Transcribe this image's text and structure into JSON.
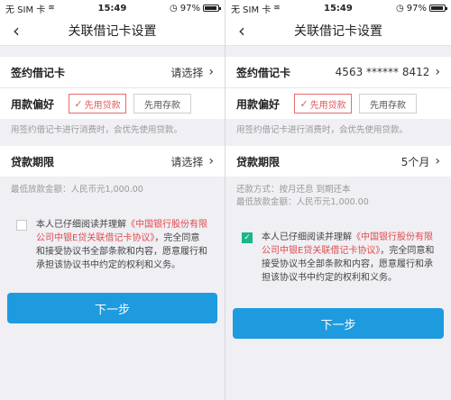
{
  "status": {
    "carrier": "无 SIM 卡",
    "time": "15:49",
    "battery": "97%"
  },
  "left": {
    "title": "关联借记卡设置",
    "card_label": "签约借记卡",
    "card_value": "请选择",
    "pref_label": "用款偏好",
    "opt_loan": "先用贷款",
    "opt_deposit": "先用存款",
    "pref_hint": "用签约借记卡进行消费时，会优先使用贷款。",
    "term_label": "贷款期限",
    "term_value": "请选择",
    "min_amount": "最低放款金额：人民币元1,000.00",
    "agree_pre": "本人已仔细阅读并理解",
    "agree_link": "《中国银行股份有限公司中银E贷关联借记卡协议》",
    "agree_post": "，完全同意和接受协议书全部条款和内容，愿意履行和承担该协议书中约定的权利和义务。",
    "agree_checked": false,
    "next": "下一步"
  },
  "right": {
    "title": "关联借记卡设置",
    "card_label": "签约借记卡",
    "card_value": "4563 ****** 8412",
    "pref_label": "用款偏好",
    "opt_loan": "先用贷款",
    "opt_deposit": "先用存款",
    "pref_hint": "用签约借记卡进行消费时，会优先使用贷款。",
    "term_label": "贷款期限",
    "term_value": "5个月",
    "repay_method": "还款方式：按月还息 到期还本",
    "min_amount": "最低放款金额：人民币元1,000.00",
    "agree_pre": "本人已仔细阅读并理解",
    "agree_link": "《中国银行股份有限公司中银E贷关联借记卡协议》",
    "agree_post": "，完全同意和接受协议书全部条款和内容，愿意履行和承担该协议书中约定的权利和义务。",
    "agree_checked": true,
    "next": "下一步"
  },
  "colors": {
    "accent": "#1e9bdf",
    "selected_red": "#e05a5a",
    "check_green": "#1bb58a"
  },
  "icons": {
    "back": "chevron-left-icon",
    "row_arrow": "chevron-right-icon",
    "check": "check-icon"
  }
}
